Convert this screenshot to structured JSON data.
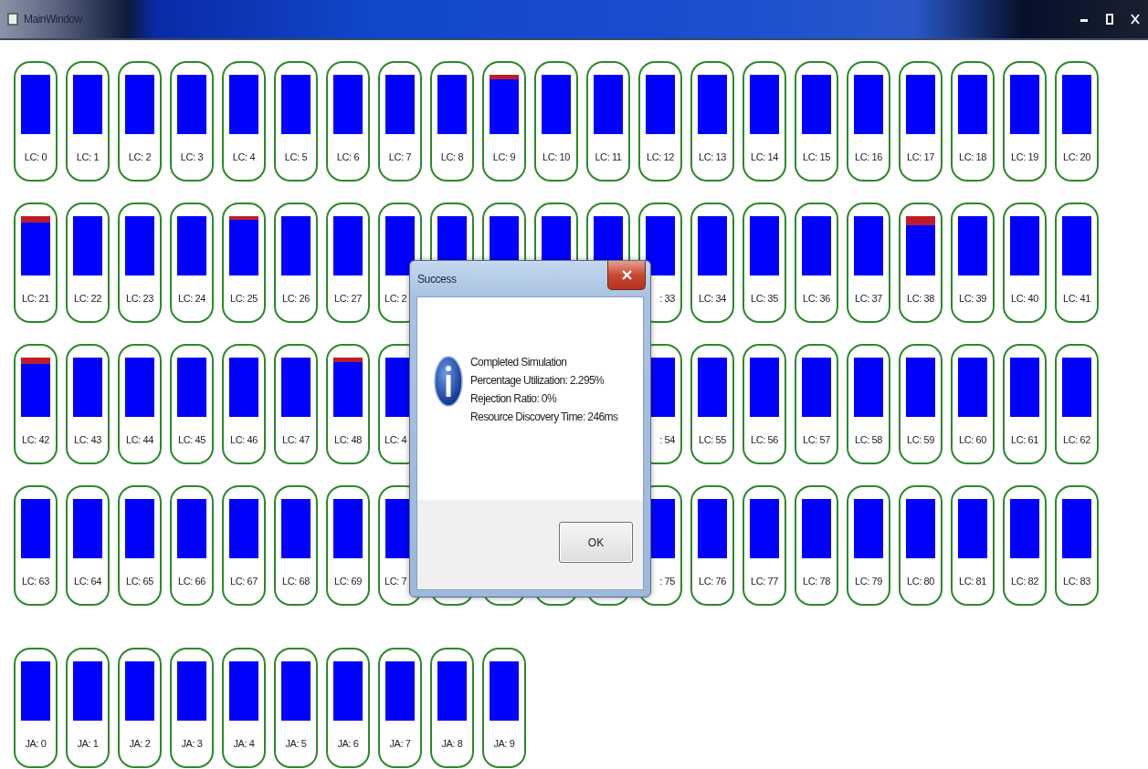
{
  "window": {
    "title": "MainWindow"
  },
  "lc_rows": [
    {
      "cells": [
        {
          "kind": "node",
          "label": "LC: 0",
          "level": 0
        },
        {
          "kind": "node",
          "label": "LC: 1",
          "level": 0
        },
        {
          "kind": "node",
          "label": "LC: 2",
          "level": 0
        },
        {
          "kind": "node",
          "label": "LC: 3",
          "level": 0
        },
        {
          "kind": "node",
          "label": "LC: 4",
          "level": 0
        },
        {
          "kind": "node",
          "label": "LC: 5",
          "level": 0
        },
        {
          "kind": "node",
          "label": "LC: 6",
          "level": 0
        },
        {
          "kind": "node",
          "label": "LC: 7",
          "level": 0
        },
        {
          "kind": "node",
          "label": "LC: 8",
          "level": 0
        },
        {
          "kind": "node",
          "label": "LC: 9",
          "level": 0.07
        },
        {
          "kind": "node",
          "label": "LC: 10",
          "level": 0
        },
        {
          "kind": "node",
          "label": "LC: 11",
          "level": 0
        },
        {
          "kind": "node",
          "label": "LC: 12",
          "level": 0
        },
        {
          "kind": "node",
          "label": "LC: 13",
          "level": 0
        },
        {
          "kind": "node",
          "label": "LC: 14",
          "level": 0
        },
        {
          "kind": "node",
          "label": "LC: 15",
          "level": 0
        },
        {
          "kind": "node",
          "label": "LC: 16",
          "level": 0
        },
        {
          "kind": "node",
          "label": "LC: 17",
          "level": 0
        },
        {
          "kind": "node",
          "label": "LC: 18",
          "level": 0
        },
        {
          "kind": "node",
          "label": "LC: 19",
          "level": 0
        },
        {
          "kind": "node",
          "label": "LC: 20",
          "level": 0
        }
      ]
    },
    {
      "cells": [
        {
          "kind": "node",
          "label": "LC: 21",
          "level": 0.1
        },
        {
          "kind": "node",
          "label": "LC: 22",
          "level": 0
        },
        {
          "kind": "node",
          "label": "LC: 23",
          "level": 0
        },
        {
          "kind": "node",
          "label": "LC: 24",
          "level": 0
        },
        {
          "kind": "node",
          "label": "LC: 25",
          "level": 0.06
        },
        {
          "kind": "node",
          "label": "LC: 26",
          "level": 0
        },
        {
          "kind": "node",
          "label": "LC: 27",
          "level": 0
        },
        {
          "kind": "clip_end",
          "label": "LC: 2",
          "level": 0
        },
        {
          "kind": "covered"
        },
        {
          "kind": "covered"
        },
        {
          "kind": "covered"
        },
        {
          "kind": "covered"
        },
        {
          "kind": "clip_start",
          "label": ": 33"
        },
        {
          "kind": "node",
          "label": "LC: 34",
          "level": 0
        },
        {
          "kind": "node",
          "label": "LC: 35",
          "level": 0
        },
        {
          "kind": "node",
          "label": "LC: 36",
          "level": 0
        },
        {
          "kind": "node",
          "label": "LC: 37",
          "level": 0
        },
        {
          "kind": "node",
          "label": "LC: 38",
          "level": 0.15
        },
        {
          "kind": "node",
          "label": "LC: 39",
          "level": 0
        },
        {
          "kind": "node",
          "label": "LC: 40",
          "level": 0
        },
        {
          "kind": "node",
          "label": "LC: 41",
          "level": 0
        }
      ]
    },
    {
      "cells": [
        {
          "kind": "node",
          "label": "LC: 42",
          "level": 0.1
        },
        {
          "kind": "node",
          "label": "LC: 43",
          "level": 0
        },
        {
          "kind": "node",
          "label": "LC: 44",
          "level": 0
        },
        {
          "kind": "node",
          "label": "LC: 45",
          "level": 0
        },
        {
          "kind": "node",
          "label": "LC: 46",
          "level": 0
        },
        {
          "kind": "node",
          "label": "LC: 47",
          "level": 0
        },
        {
          "kind": "node",
          "label": "LC: 48",
          "level": 0.07
        },
        {
          "kind": "clip_end",
          "label": "LC: 4"
        },
        {
          "kind": "hidden"
        },
        {
          "kind": "hidden"
        },
        {
          "kind": "hidden"
        },
        {
          "kind": "hidden"
        },
        {
          "kind": "clip_start",
          "label": ": 54"
        },
        {
          "kind": "node",
          "label": "LC: 55",
          "level": 0
        },
        {
          "kind": "node",
          "label": "LC: 56",
          "level": 0
        },
        {
          "kind": "node",
          "label": "LC: 57",
          "level": 0
        },
        {
          "kind": "node",
          "label": "LC: 58",
          "level": 0
        },
        {
          "kind": "node",
          "label": "LC: 59",
          "level": 0
        },
        {
          "kind": "node",
          "label": "LC: 60",
          "level": 0
        },
        {
          "kind": "node",
          "label": "LC: 61",
          "level": 0
        },
        {
          "kind": "node",
          "label": "LC: 62",
          "level": 0
        }
      ]
    },
    {
      "cells": [
        {
          "kind": "node",
          "label": "LC: 63",
          "level": 0
        },
        {
          "kind": "node",
          "label": "LC: 64",
          "level": 0
        },
        {
          "kind": "node",
          "label": "LC: 65",
          "level": 0
        },
        {
          "kind": "node",
          "label": "LC: 66",
          "level": 0
        },
        {
          "kind": "node",
          "label": "LC: 67",
          "level": 0
        },
        {
          "kind": "node",
          "label": "LC: 68",
          "level": 0
        },
        {
          "kind": "node",
          "label": "LC: 69",
          "level": 0
        },
        {
          "kind": "clip_end",
          "label": "LC: 7"
        },
        {
          "kind": "outline"
        },
        {
          "kind": "outline"
        },
        {
          "kind": "outline"
        },
        {
          "kind": "outline"
        },
        {
          "kind": "clip_start",
          "label": ": 75"
        },
        {
          "kind": "node",
          "label": "LC: 76",
          "level": 0
        },
        {
          "kind": "node",
          "label": "LC: 77",
          "level": 0
        },
        {
          "kind": "node",
          "label": "LC: 78",
          "level": 0
        },
        {
          "kind": "node",
          "label": "LC: 79",
          "level": 0
        },
        {
          "kind": "node",
          "label": "LC: 80",
          "level": 0
        },
        {
          "kind": "node",
          "label": "LC: 81",
          "level": 0
        },
        {
          "kind": "node",
          "label": "LC: 82",
          "level": 0
        },
        {
          "kind": "node",
          "label": "LC: 83",
          "level": 0
        }
      ]
    }
  ],
  "ja_cells": [
    {
      "kind": "node",
      "label": "JA: 0",
      "level": 0
    },
    {
      "kind": "node",
      "label": "JA: 1",
      "level": 0
    },
    {
      "kind": "node",
      "label": "JA: 2",
      "level": 0
    },
    {
      "kind": "node",
      "label": "JA: 3",
      "level": 0
    },
    {
      "kind": "node",
      "label": "JA: 4",
      "level": 0
    },
    {
      "kind": "node",
      "label": "JA: 5",
      "level": 0
    },
    {
      "kind": "node",
      "label": "JA: 6",
      "level": 0
    },
    {
      "kind": "node",
      "label": "JA: 7",
      "level": 0
    },
    {
      "kind": "node",
      "label": "JA: 8",
      "level": 0
    },
    {
      "kind": "node",
      "label": "JA: 9",
      "level": 0
    }
  ],
  "dialog": {
    "title": "Success",
    "lines": [
      "Completed Simulation",
      "Percentage Utilization: 2.295%",
      "Rejection Ratio: 0%",
      "Resource Discovery Time: 246ms"
    ],
    "button": "OK"
  }
}
